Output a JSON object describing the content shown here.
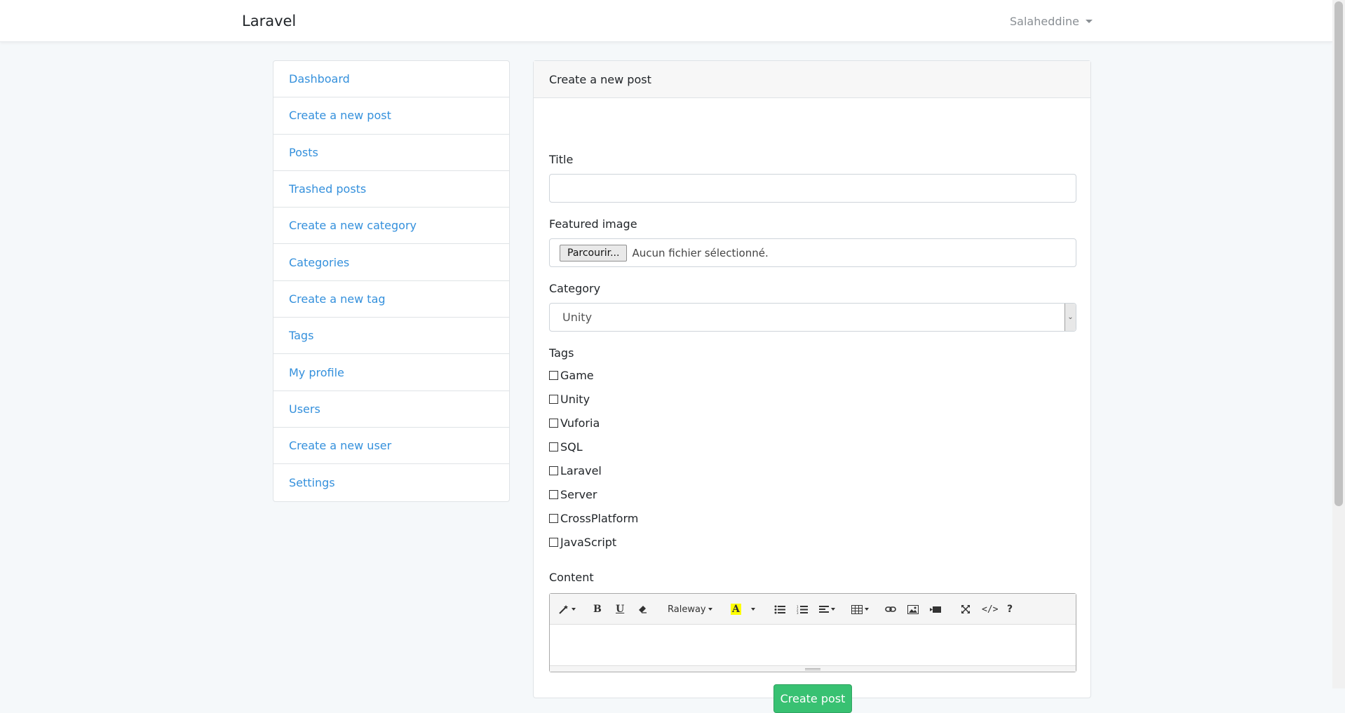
{
  "navbar": {
    "brand": "Laravel",
    "user": "Salaheddine"
  },
  "sidebar": {
    "items": [
      {
        "label": "Dashboard"
      },
      {
        "label": "Create a new post"
      },
      {
        "label": "Posts"
      },
      {
        "label": "Trashed posts"
      },
      {
        "label": "Create a new category"
      },
      {
        "label": "Categories"
      },
      {
        "label": "Create a new tag"
      },
      {
        "label": "Tags"
      },
      {
        "label": "My profile"
      },
      {
        "label": "Users"
      },
      {
        "label": "Create a new user"
      },
      {
        "label": "Settings"
      }
    ]
  },
  "form": {
    "header": "Create a new post",
    "title_label": "Title",
    "title_value": "",
    "image_label": "Featured image",
    "browse_label": "Parcourir...",
    "file_status": "Aucun fichier sélectionné.",
    "category_label": "Category",
    "category_value": "Unity",
    "tags_label": "Tags",
    "tags": [
      {
        "label": "Game",
        "checked": false
      },
      {
        "label": "Unity",
        "checked": false
      },
      {
        "label": "Vuforia",
        "checked": false
      },
      {
        "label": "SQL",
        "checked": false
      },
      {
        "label": "Laravel",
        "checked": false
      },
      {
        "label": "Server",
        "checked": false
      },
      {
        "label": "CrossPlatform",
        "checked": false
      },
      {
        "label": "JavaScript",
        "checked": false
      }
    ],
    "content_label": "Content",
    "editor": {
      "font_name": "Raleway",
      "content": ""
    },
    "submit_label": "Create post"
  },
  "colors": {
    "link": "#3490dc",
    "success": "#38c172",
    "background": "#f5f8fa"
  }
}
